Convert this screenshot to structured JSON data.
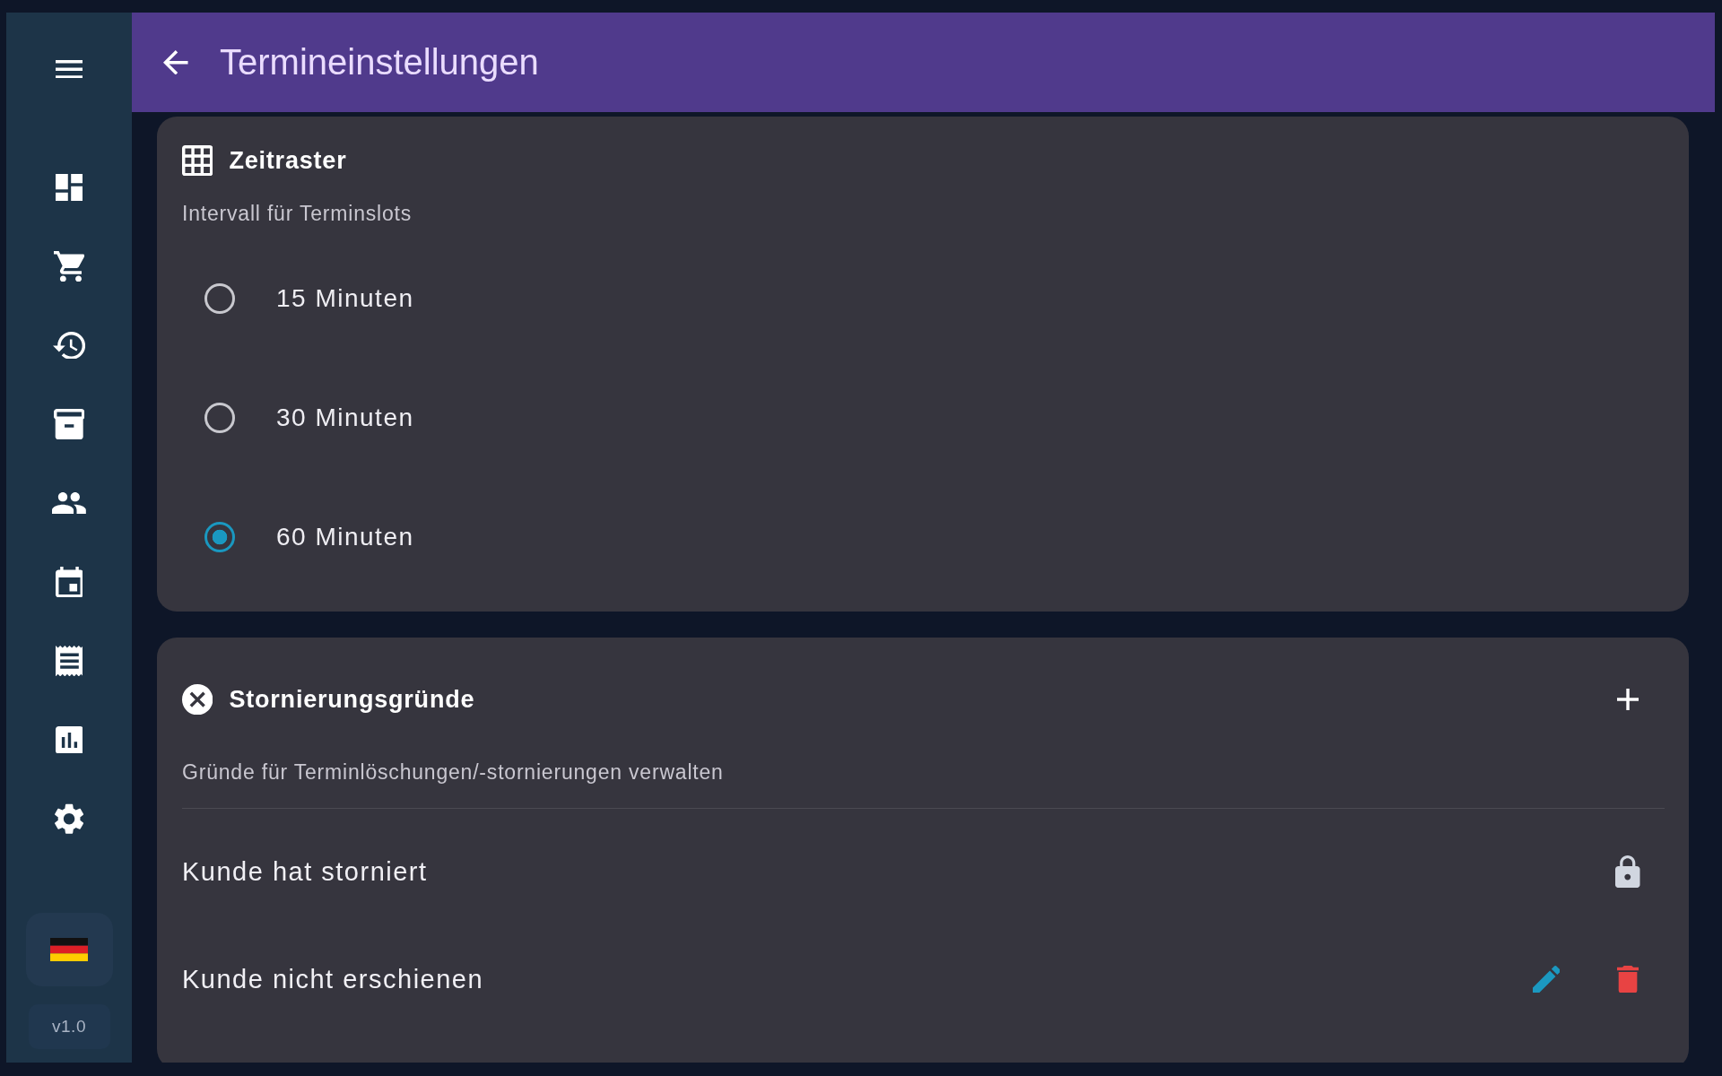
{
  "sidebar": {
    "version": "v1.0"
  },
  "header": {
    "title": "Termineinstellungen"
  },
  "time_grid_card": {
    "title": "Zeitraster",
    "subtitle": "Intervall für Terminslots",
    "options": [
      {
        "label": "15 Minuten",
        "selected": false
      },
      {
        "label": "30 Minuten",
        "selected": false
      },
      {
        "label": "60 Minuten",
        "selected": true
      }
    ]
  },
  "cancellation_reasons_card": {
    "title": "Stornierungsgründe",
    "subtitle": "Gründe für Terminlöschungen/-stornierungen verwalten",
    "reasons": [
      {
        "label": "Kunde hat storniert",
        "locked": true
      },
      {
        "label": "Kunde nicht erschienen",
        "locked": false
      }
    ]
  }
}
